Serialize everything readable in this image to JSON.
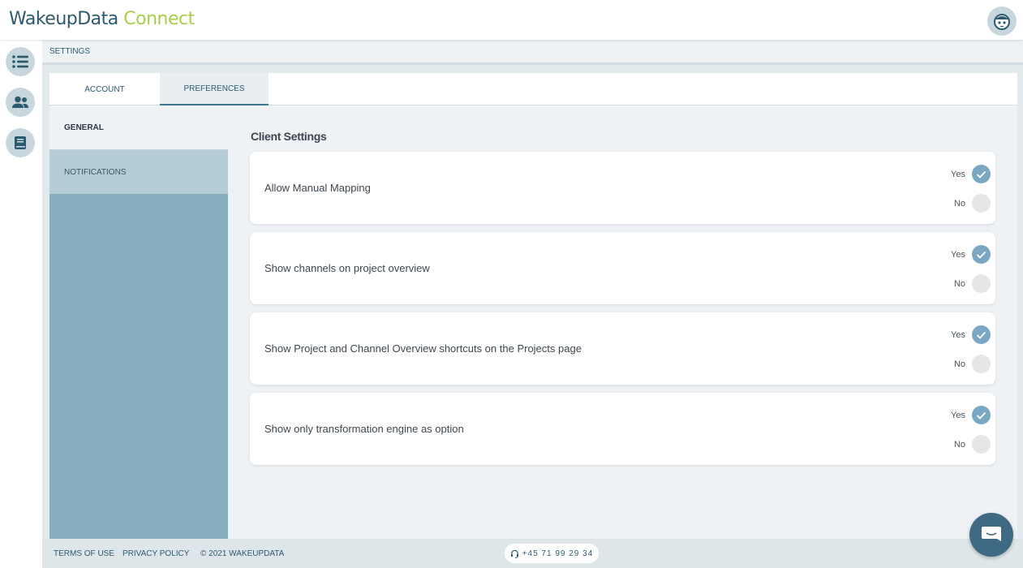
{
  "app": {
    "logo_part1": "WakeupData",
    "logo_part2": "Connect"
  },
  "breadcrumb": "SETTINGS",
  "tabs": [
    {
      "label": "ACCOUNT",
      "active": false
    },
    {
      "label": "PREFERENCES",
      "active": true
    }
  ],
  "subnav": [
    {
      "label": "GENERAL",
      "active": true
    },
    {
      "label": "NOTIFICATIONS",
      "active": false
    }
  ],
  "section_title": "Client Settings",
  "yes_label": "Yes",
  "no_label": "No",
  "settings": [
    {
      "label": "Allow Manual Mapping",
      "value": "Yes"
    },
    {
      "label": "Show channels on project overview",
      "value": "Yes"
    },
    {
      "label": "Show Project and Channel Overview shortcuts on the Projects page",
      "value": "Yes"
    },
    {
      "label": "Show only transformation engine as option",
      "value": "Yes"
    }
  ],
  "footer": {
    "terms": "TERMS OF USE",
    "privacy": "PRIVACY POLICY",
    "copyright": "© 2021 WAKEUPDATA",
    "phone": "+45 71 99 29 34"
  },
  "colors": {
    "brand_dark": "#2c5a6e",
    "brand_green": "#a6cf4c",
    "radio_selected": "#7aa7c2",
    "sidebar": "#87aebe"
  },
  "icons": {
    "nav1": "list-icon",
    "nav2": "users-icon",
    "nav3": "book-icon",
    "avatar": "robot-face-icon",
    "chat": "chat-bubble-icon",
    "phone": "headset-icon"
  }
}
